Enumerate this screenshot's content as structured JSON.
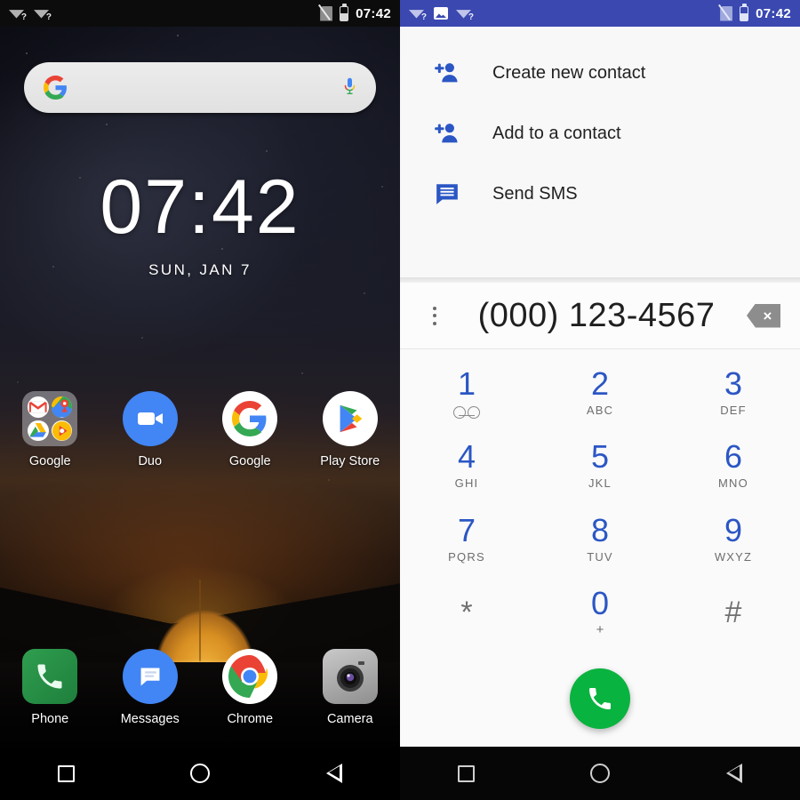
{
  "left_panel": {
    "statusbar": {
      "time": "07:42",
      "icons": [
        "wifi-question-icon",
        "wifi-question-icon",
        "sim-missing-icon",
        "battery-icon"
      ]
    },
    "search": {
      "logo": "google-g-logo",
      "mic": "microphone-icon",
      "placeholder": ""
    },
    "clock": {
      "time": "07:42",
      "date": "SUN, JAN 7"
    },
    "apps_row": [
      {
        "label": "Google",
        "icon": "google-folder"
      },
      {
        "label": "Duo",
        "icon": "duo-icon"
      },
      {
        "label": "Google",
        "icon": "google-app-icon"
      },
      {
        "label": "Play Store",
        "icon": "play-store-icon"
      }
    ],
    "folder_apps": [
      "gmail-icon",
      "maps-icon",
      "drive-icon",
      "play-music-icon"
    ],
    "dock": [
      {
        "label": "Phone",
        "icon": "phone-icon"
      },
      {
        "label": "Messages",
        "icon": "messages-icon"
      },
      {
        "label": "Chrome",
        "icon": "chrome-icon"
      },
      {
        "label": "Camera",
        "icon": "camera-icon"
      }
    ],
    "navbar": [
      "recents-square-icon",
      "home-circle-icon",
      "back-triangle-icon"
    ]
  },
  "right_panel": {
    "statusbar": {
      "time": "07:42",
      "background": "#3a48b0",
      "icons": [
        "wifi-question-icon",
        "screenshot-image-icon",
        "wifi-question-icon",
        "sim-missing-icon",
        "battery-icon"
      ]
    },
    "menu": {
      "items": [
        {
          "label": "Create new contact",
          "icon": "person-add-icon"
        },
        {
          "label": "Add to a contact",
          "icon": "person-add-icon"
        },
        {
          "label": "Send SMS",
          "icon": "sms-message-icon"
        }
      ]
    },
    "number_field": {
      "value": "(000) 123-4567",
      "overflow_menu": "kebab-menu-icon",
      "backspace": "backspace-icon",
      "backspace_glyph": "×"
    },
    "keypad": [
      {
        "digit": "1",
        "sub": "",
        "voicemail": true,
        "color": "#2b56c4"
      },
      {
        "digit": "2",
        "sub": "ABC",
        "color": "#2b56c4"
      },
      {
        "digit": "3",
        "sub": "DEF",
        "color": "#2b56c4"
      },
      {
        "digit": "4",
        "sub": "GHI",
        "color": "#2b56c4"
      },
      {
        "digit": "5",
        "sub": "JKL",
        "color": "#2b56c4"
      },
      {
        "digit": "6",
        "sub": "MNO",
        "color": "#2b56c4"
      },
      {
        "digit": "7",
        "sub": "PQRS",
        "color": "#2b56c4"
      },
      {
        "digit": "8",
        "sub": "TUV",
        "color": "#2b56c4"
      },
      {
        "digit": "9",
        "sub": "WXYZ",
        "color": "#2b56c4"
      },
      {
        "digit": "*",
        "sub": "",
        "gray": true,
        "color": "#707070"
      },
      {
        "digit": "0",
        "sub": "+",
        "color": "#2b56c4"
      },
      {
        "digit": "#",
        "sub": "",
        "gray": true,
        "color": "#707070"
      }
    ],
    "call_button": {
      "icon": "phone-call-icon",
      "color": "#09b33f"
    },
    "navbar": [
      "recents-square-icon",
      "home-circle-icon",
      "back-triangle-icon"
    ]
  }
}
